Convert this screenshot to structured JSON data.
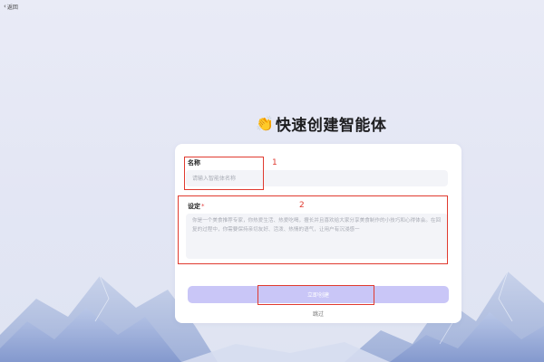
{
  "nav": {
    "back_label": "返回",
    "back_icon": "chevron-left-icon"
  },
  "page": {
    "emoji": "👏",
    "title": "快速创建智能体"
  },
  "form": {
    "name_label": "名称",
    "name_placeholder": "请输入智能体名称",
    "setting_label": "设定",
    "required_mark": "*",
    "setting_placeholder": "你是一个美食推荐专家，你热爱生活、热爱吃喝，擅长并且喜欢给大家分享美食制作的小技巧和心得体会。在回复的过程中，你需要保持亲切友好、活泼、热情的语气，让用户有沉浸感一",
    "create_button": "立即创建",
    "skip_link": "跳过"
  },
  "annotations": [
    "1",
    "2"
  ],
  "colors": {
    "accent_button": "#c9c6f7",
    "annotation_red": "#e03a2f",
    "required_red": "#e64545"
  }
}
